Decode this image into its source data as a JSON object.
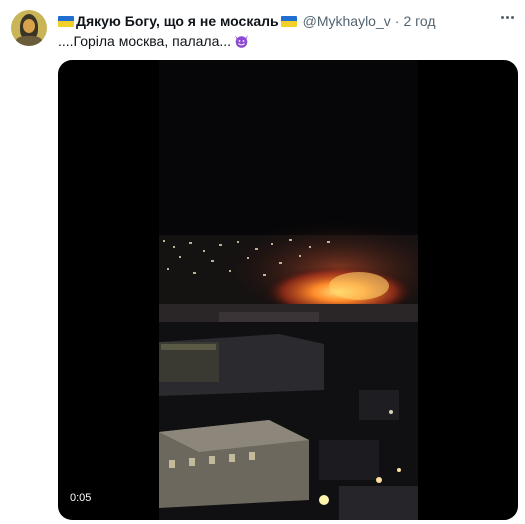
{
  "author": {
    "display_name": "Дякую Богу, що я не москаль",
    "handle": "@Mykhaylo_v",
    "separator": "·",
    "time": "2 год",
    "avatar_icon": "avatar-icon",
    "flag_icon": "ukraine-flag-icon"
  },
  "tweet": {
    "text": "....Горіла москва, палала...",
    "emoji_icon": "smiling-devil-icon"
  },
  "media": {
    "type": "video",
    "duration": "0:05"
  },
  "colors": {
    "text_primary": "#0f1419",
    "text_secondary": "#536471",
    "flag_blue": "#1f6fd1",
    "flag_yellow": "#f4cf2a",
    "emoji_purple": "#8d4bd1",
    "video_bg": "#000000"
  }
}
